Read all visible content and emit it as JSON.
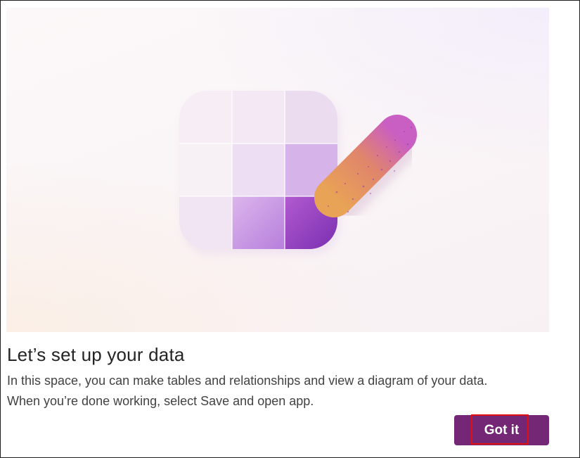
{
  "dialog": {
    "title": "Let’s set up your data",
    "body_line1": "In this space, you can make tables and relationships and view a diagram of your data.",
    "body_line2": "When you’re done working, select Save and open app.",
    "got_it_label": "Got it"
  },
  "illustration": {
    "icons": [
      "table-grid-icon",
      "pencil-icon"
    ]
  },
  "colors": {
    "button_background": "#742774",
    "button_text": "#ffffff",
    "title_text": "#242424",
    "body_text": "#424242",
    "highlight_outline": "#e01010"
  }
}
